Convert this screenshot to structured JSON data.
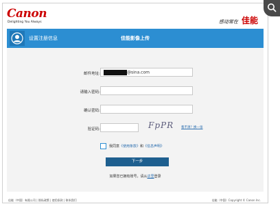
{
  "brand": {
    "logo": "Canon",
    "tagline": "Delighting You Always",
    "slogan_small": "感动常在",
    "slogan_big": "佳能"
  },
  "banner": {
    "left_title": "设置注册信息",
    "center_title": "佳能影像上传"
  },
  "form": {
    "email_label": "邮件地址:",
    "email_suffix": "@sina.com",
    "password_label": "请输入密码:",
    "confirm_label": "确认密码:",
    "captcha_label": "验证码:",
    "captcha_text": "FpPR",
    "refresh_link": "看不清？换一张",
    "agree_prefix": "我同意",
    "terms_link": "《使用条款》",
    "agree_and": "和",
    "privacy_link": "《信息声明》",
    "next_button": "下一步",
    "login_prefix": "如果您已拥有账号，请从",
    "login_link": "这里",
    "login_suffix": "登录"
  },
  "footer": {
    "left": "佳能（中国）有限公司 | 隐私政策 | 使用条款 | 联系我们",
    "right": "佳能（中国）Copyright © Canon Inc."
  },
  "colors": {
    "brand_red": "#cc0000",
    "banner_blue": "#2c8ed2",
    "button_navy": "#1e5f8f"
  }
}
